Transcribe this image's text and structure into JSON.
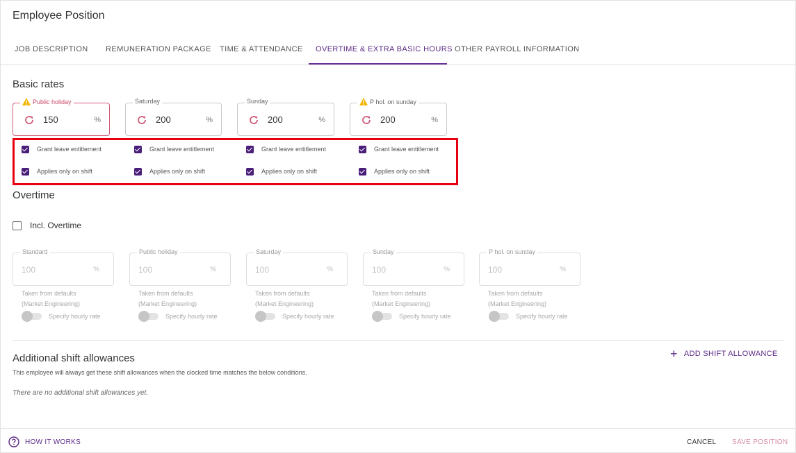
{
  "page": {
    "title": "Employee Position"
  },
  "tabs": [
    {
      "label": "JOB DESCRIPTION"
    },
    {
      "label": "REMUNERATION PACKAGE"
    },
    {
      "label": "TIME & ATTENDANCE"
    },
    {
      "label": "OVERTIME & EXTRA BASIC HOURS",
      "active": true
    },
    {
      "label": "OTHER PAYROLL INFORMATION"
    }
  ],
  "basic_rates": {
    "title": "Basic rates",
    "fields": [
      {
        "label": "Public holiday",
        "value": "150",
        "unit": "%",
        "warning": true,
        "icon": "refresh-icon"
      },
      {
        "label": "Saturday",
        "value": "200",
        "unit": "%",
        "warning": false,
        "icon": "refresh-icon"
      },
      {
        "label": "Sunday",
        "value": "200",
        "unit": "%",
        "warning": false,
        "icon": "refresh-icon"
      },
      {
        "label": "P hol. on sunday",
        "value": "200",
        "unit": "%",
        "warning": true,
        "icon": "refresh-icon"
      }
    ],
    "checkboxes": {
      "grant_label": "Grant leave entitlement",
      "shift_label": "Applies only on shift",
      "checked": true
    }
  },
  "overtime": {
    "title": "Overtime",
    "incl_label": "Incl. Overtime",
    "incl_checked": false,
    "fields": [
      {
        "label": "Standard",
        "placeholder": "100",
        "unit": "%"
      },
      {
        "label": "Public holiday",
        "placeholder": "100",
        "unit": "%"
      },
      {
        "label": "Saturday",
        "placeholder": "100",
        "unit": "%"
      },
      {
        "label": "Sunday",
        "placeholder": "100",
        "unit": "%"
      },
      {
        "label": "P hol. on sunday",
        "placeholder": "100",
        "unit": "%"
      }
    ],
    "helper_line1": "Taken from defaults",
    "helper_line2": "(Market Engineering)",
    "toggle_label": "Specify hourly rate"
  },
  "shift_allowances": {
    "title": "Additional shift allowances",
    "description": "This employee will always get these shift allowances when the clocked time matches the below conditions.",
    "empty": "There are no additional shift allowances yet.",
    "add_label": "ADD SHIFT ALLOWANCE"
  },
  "footer": {
    "how_label": "HOW IT WORKS",
    "cancel_label": "CANCEL",
    "save_label": "SAVE POSITION"
  },
  "colors": {
    "accent": "#5b2a86",
    "error": "#d25b78",
    "warning": "#f5b400",
    "highlight": "#e60012"
  }
}
